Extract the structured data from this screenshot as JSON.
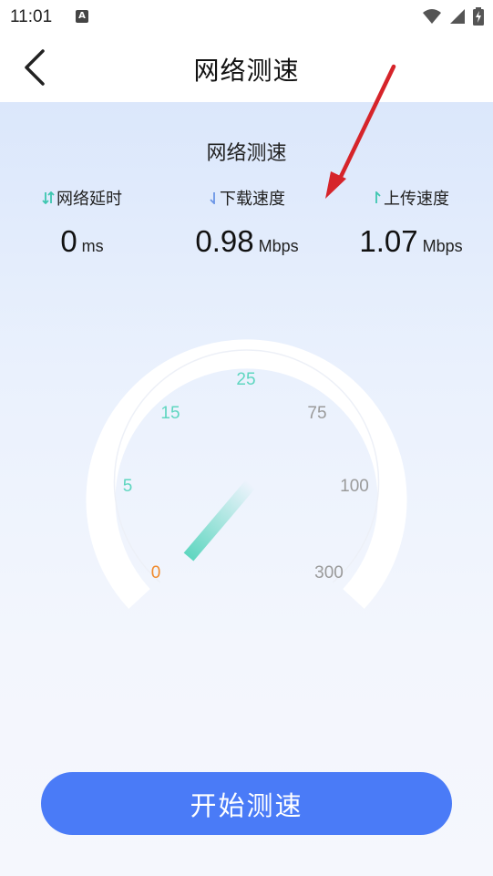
{
  "status_bar": {
    "time": "11:01",
    "a_icon_text": "A"
  },
  "header": {
    "title": "网络测速"
  },
  "main": {
    "section_title": "网络测速",
    "metrics": [
      {
        "label": "网络延时",
        "value": "0",
        "unit": "ms",
        "icon": "updown-arrows-icon"
      },
      {
        "label": "下载速度",
        "value": "0.98",
        "unit": "Mbps",
        "icon": "down-arrow-icon"
      },
      {
        "label": "上传速度",
        "value": "1.07",
        "unit": "Mbps",
        "icon": "up-arrow-icon"
      }
    ],
    "gauge": {
      "ticks": [
        "0",
        "5",
        "15",
        "25",
        "75",
        "100",
        "300"
      ],
      "needle_value": 0
    },
    "start_button": "开始测速"
  },
  "colors": {
    "accent": "#4a7bf7",
    "teal": "#5fd6c0",
    "orange": "#f08a2c",
    "tick_gray": "#9a9a9a",
    "arrow_red": "#d6242a"
  }
}
